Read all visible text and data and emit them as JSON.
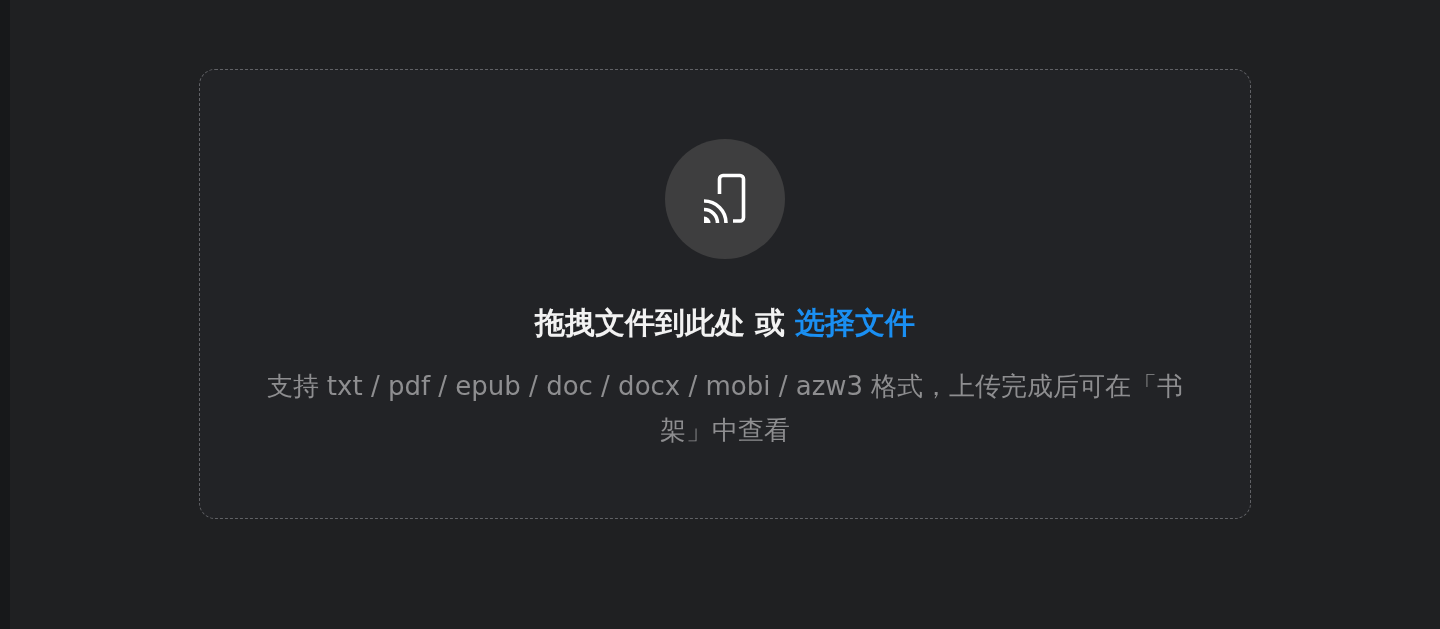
{
  "upload_area": {
    "prompt": "拖拽文件到此处 或",
    "link": "选择文件",
    "hint": "支持 txt / pdf / epub / doc / docx / mobi / azw3 格式，上传完成后可在「书架」中查看"
  }
}
